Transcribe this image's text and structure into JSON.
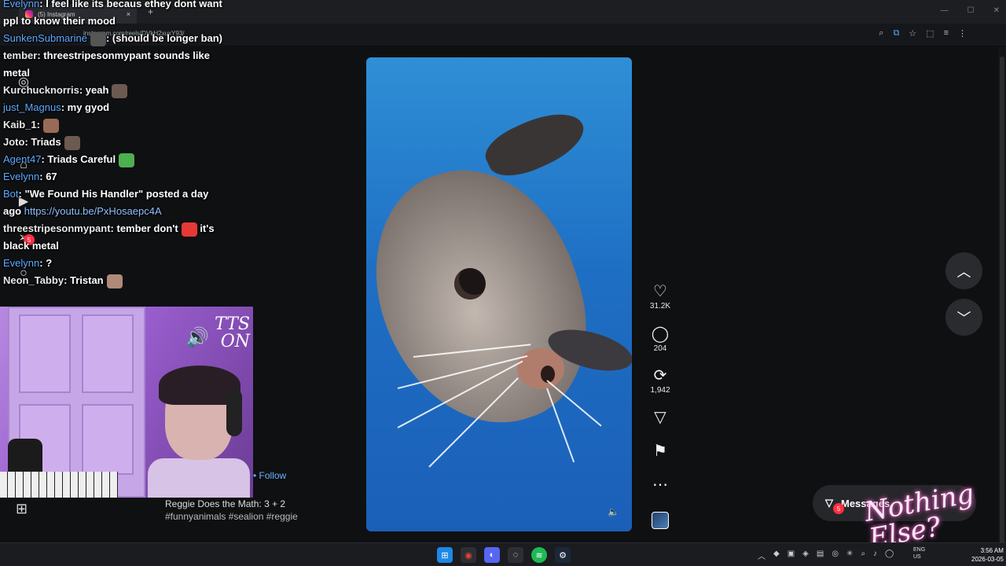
{
  "browser": {
    "tab_title": "(5) Instagram",
    "url": "instagram.com/reels/DVkH2xuxY93/",
    "new_tab": "+",
    "close_tab": "×",
    "window_controls": [
      "—",
      "☐",
      "✕"
    ]
  },
  "chat": [
    {
      "user": "Evelynn",
      "user_color": "blue",
      "text": ": I feel like its becaus ethey dont want ppl to know their mood"
    },
    {
      "user": "SunkenSubmarine",
      "user_color": "blue",
      "text": ": (should be longer ban)"
    },
    {
      "user": "tember",
      "user_color": "white",
      "text": ": threestripesonmypant sounds like metal"
    },
    {
      "user": "Kurchucknorris",
      "user_color": "white",
      "text": ": yeah"
    },
    {
      "user": "just_Magnus",
      "user_color": "blue",
      "text": ": my gyod"
    },
    {
      "user": "Kaib_1",
      "user_color": "white",
      "text": ":"
    },
    {
      "user": "Joto",
      "user_color": "white",
      "text": ": Triads"
    },
    {
      "user": "Agent47",
      "user_color": "blue",
      "text": ": Triads Careful"
    },
    {
      "user": "Evelynn",
      "user_color": "blue",
      "text": ": 67"
    },
    {
      "user": "Bot",
      "user_color": "blue",
      "text": ": \"We Found His Handler\" posted a day ago",
      "link": "https://youtu.be/PxHosaepc4A"
    },
    {
      "user": "threestripesonmypant",
      "user_color": "white",
      "text": ": tember don't",
      "tail": " it's black metal"
    },
    {
      "user": "Evelynn",
      "user_color": "blue",
      "text": ": ?"
    },
    {
      "user": "Neon_Tabby",
      "user_color": "white",
      "text": ": Tristan"
    }
  ],
  "overlay": {
    "tts_line1": "TTS",
    "tts_line2": "ON",
    "nothing_else": "Nothing Else?"
  },
  "reel": {
    "follow": "Follow",
    "caption": "Reggie Does the Math: 3 + 2",
    "hashtags": "#funnyanimals #sealion #reggie",
    "likes": "31.2K",
    "comments": "204",
    "reposts": "1,942"
  },
  "messages": {
    "label": "Messages",
    "badge": "5"
  },
  "nav_badge": "5",
  "taskbar": {
    "lang_top": "ENG",
    "lang_bottom": "US",
    "time": "3:56 AM",
    "date": "2026-03-05"
  },
  "colors": {
    "link_blue": "#5da9ff",
    "badge_red": "#ff3040",
    "video_blue": "#1e6fc4"
  }
}
